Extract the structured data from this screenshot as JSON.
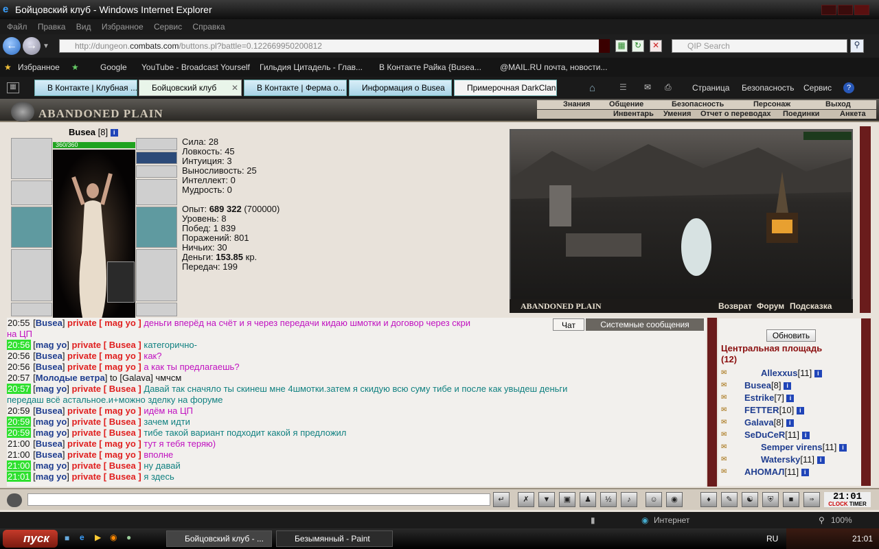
{
  "window": {
    "title": "Бойцовский клуб - Windows Internet Explorer"
  },
  "menu": [
    "Файл",
    "Правка",
    "Вид",
    "Избранное",
    "Сервис",
    "Справка"
  ],
  "address": {
    "url_prefix": "http://dungeon.",
    "url_domain": "combats.com",
    "url_suffix": "/buttons.pl?battle=0.122669950200812",
    "search_placeholder": "QIP Search"
  },
  "favorites": {
    "label": "Избранное",
    "items": [
      "Google",
      "YouTube - Broadcast Yourself",
      "Гильдия Цитадель - Глав...",
      "В Контакте  Райка {Busea...",
      "@MAIL.RU почта, новости..."
    ]
  },
  "tabs": [
    {
      "label": "В Контакте | Клубная ..."
    },
    {
      "label": "Бойцовский клуб",
      "active": true
    },
    {
      "label": "В Контакте | Ферма о..."
    },
    {
      "label": "Информация о Busea"
    },
    {
      "label": "Примерочная DarkClan"
    }
  ],
  "commands": [
    "Страница",
    "Безопасность",
    "Сервис"
  ],
  "game": {
    "logo": "ABANDONED PLAIN",
    "top_menu": [
      "Знания",
      "Общение",
      "Безопасность",
      "Персонаж",
      "Выход"
    ],
    "sub_menu": [
      "Инвентарь",
      "Умения",
      "Отчет о переводах",
      "Поединки",
      "Анкета"
    ],
    "character": {
      "name": "Busea",
      "level": "[8]",
      "hp": "360/360",
      "stats": [
        {
          "label": "Сила:",
          "value": "28"
        },
        {
          "label": "Ловкость:",
          "value": "45"
        },
        {
          "label": "Интуиция:",
          "value": "3"
        },
        {
          "label": "Выносливость:",
          "value": "25"
        },
        {
          "label": "Интеллект:",
          "value": "0"
        },
        {
          "label": "Мудрость:",
          "value": "0"
        }
      ],
      "exp_label": "Опыт:",
      "exp_value": "689 322",
      "exp_next": "(700000)",
      "level_label": "Уровень:",
      "level_value": "8",
      "wins_label": "Побед:",
      "wins_value": "1 839",
      "losses_label": "Поражений:",
      "losses_value": "801",
      "draws_label": "Ничьих:",
      "draws_value": "30",
      "money_label": "Деньги:",
      "money_value": "153.85",
      "money_unit": "кр.",
      "transfers_label": "Передач:",
      "transfers_value": "199"
    },
    "scene": {
      "title": "ABANDONED PLAIN",
      "links": [
        "Возврат",
        "Форум",
        "Подсказка"
      ]
    },
    "chat_tabs": [
      "Чат",
      "Системные сообщения"
    ],
    "chat": [
      {
        "time": "20:55",
        "hl": false,
        "from": "Busea",
        "to": "mag yo",
        "text": "деньги вперёд на счёт и я через передачи кидаю шмотки и договор через скри",
        "color": "m"
      },
      {
        "time": "",
        "hl": false,
        "from": "",
        "to": "",
        "text": "на ЦП",
        "color": "m"
      },
      {
        "time": "20:56",
        "hl": true,
        "from": "mag yo",
        "to": "Busea",
        "text": "категорично-",
        "color": "t"
      },
      {
        "time": "20:56",
        "hl": false,
        "from": "Busea",
        "to": "mag yo",
        "text": "как?",
        "color": "m"
      },
      {
        "time": "20:56",
        "hl": false,
        "from": "Busea",
        "to": "mag yo",
        "text": "а как ты предлагаешь?",
        "color": "m"
      },
      {
        "time": "20:57",
        "hl": false,
        "from": "Молодые ветра",
        "to": "",
        "text": "to [Galava] чмчсм",
        "color": "n"
      },
      {
        "time": "20:57",
        "hl": true,
        "from": "mag yo",
        "to": "Busea",
        "text": "Давай так сначяло ты скинеш мне 4шмотки.затем я скидую всю суму тибе и после как увыдеш деньги",
        "color": "t"
      },
      {
        "time": "",
        "hl": false,
        "from": "",
        "to": "",
        "text": "передаш всё астальное.и+можно зделку на форуме",
        "color": "t"
      },
      {
        "time": "20:59",
        "hl": false,
        "from": "Busea",
        "to": "mag yo",
        "text": "идём на ЦП",
        "color": "m"
      },
      {
        "time": "20:59",
        "hl": true,
        "from": "mag yo",
        "to": "Busea",
        "text": "зачем идти",
        "color": "t"
      },
      {
        "time": "20:59",
        "hl": true,
        "from": "mag yo",
        "to": "Busea",
        "text": "тибе такой вариант подходит какой я предложил",
        "color": "t"
      },
      {
        "time": "21:00",
        "hl": false,
        "from": "Busea",
        "to": "mag yo",
        "text": "тут я тебя теряю)",
        "color": "m"
      },
      {
        "time": "21:00",
        "hl": false,
        "from": "Busea",
        "to": "mag yo",
        "text": "вполне",
        "color": "m"
      },
      {
        "time": "21:00",
        "hl": true,
        "from": "mag yo",
        "to": "Busea",
        "text": "ну давай",
        "color": "t"
      },
      {
        "time": "21:01",
        "hl": true,
        "from": "mag yo",
        "to": "Busea",
        "text": "я здесь",
        "color": "t"
      }
    ],
    "private_word": "private",
    "online": {
      "refresh": "Обновить",
      "room": "Центральная площадь",
      "count": "(12)",
      "users": [
        {
          "name": "Allexxus",
          "level": "[11]"
        },
        {
          "name": "Busea",
          "level": "[8]"
        },
        {
          "name": "Estrike",
          "level": "[7]"
        },
        {
          "name": "FETTER",
          "level": "[10]"
        },
        {
          "name": "Galava",
          "level": "[8]"
        },
        {
          "name": "SeDuCeR",
          "level": "[11]"
        },
        {
          "name": "Semper virens",
          "level": "[11]"
        },
        {
          "name": "Watersky",
          "level": "[11]"
        },
        {
          "name": "АНОМАЛ",
          "level": "[11]"
        }
      ]
    },
    "clock": "21:01",
    "clock_labels": [
      "CLOCK",
      "TIMER"
    ]
  },
  "status": {
    "zone": "Интернет",
    "zoom": "100%"
  },
  "taskbar": {
    "start": "пуск",
    "tasks": [
      "Бойцовский клуб - ...",
      "Безымянный - Paint"
    ],
    "lang": "RU",
    "time": "21:01"
  }
}
